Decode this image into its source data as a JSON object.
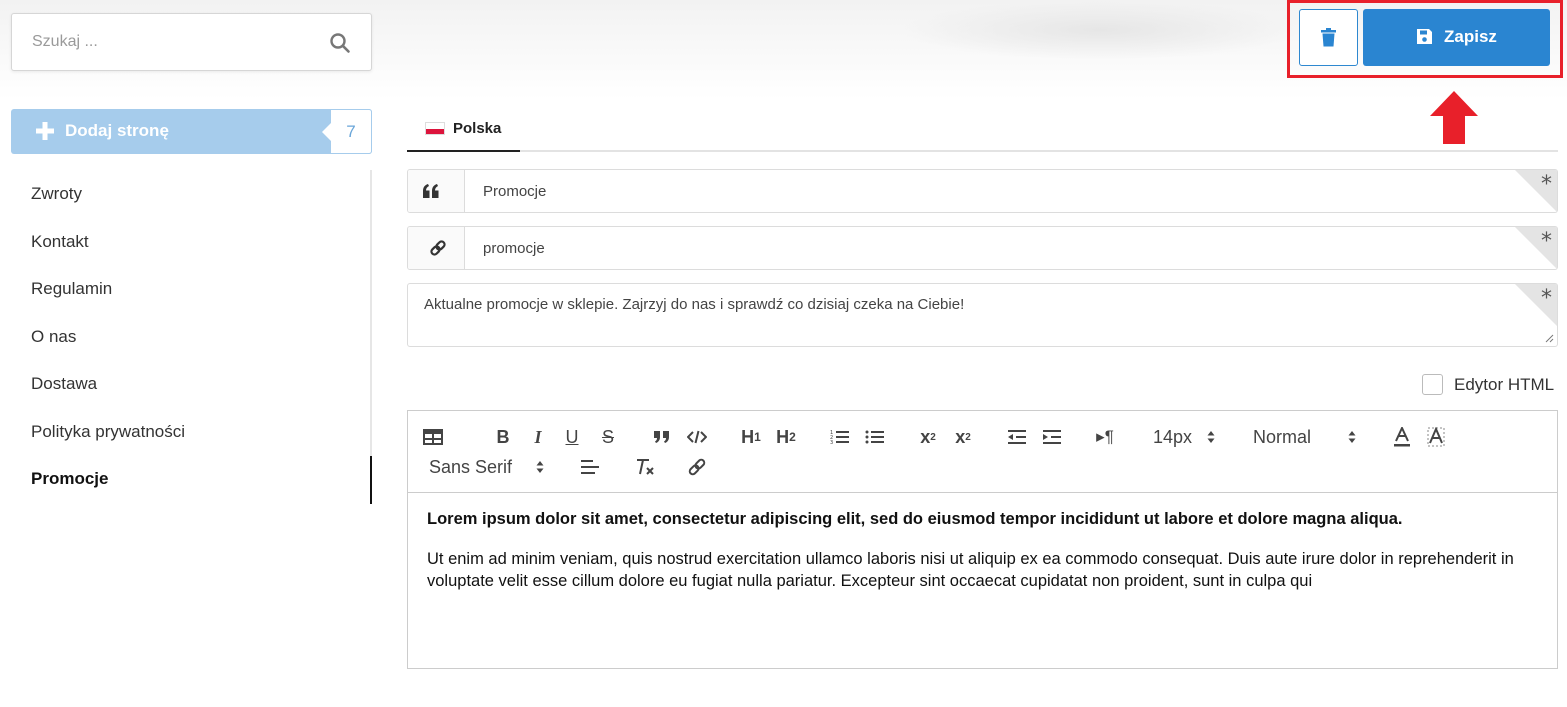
{
  "search": {
    "placeholder": "Szukaj ..."
  },
  "add_page": {
    "label": "Dodaj stronę",
    "count": "7"
  },
  "pages": [
    {
      "label": "Zwroty",
      "active": false
    },
    {
      "label": "Kontakt",
      "active": false
    },
    {
      "label": "Regulamin",
      "active": false
    },
    {
      "label": "O nas",
      "active": false
    },
    {
      "label": "Dostawa",
      "active": false
    },
    {
      "label": "Polityka prywatności",
      "active": false
    },
    {
      "label": "Promocje",
      "active": true
    }
  ],
  "actions": {
    "save_label": "Zapisz",
    "delete_icon": "trash-icon",
    "save_icon": "floppy-disk-icon"
  },
  "tabs": [
    {
      "label": "Polska",
      "flag": "pl-flag-icon",
      "active": true
    }
  ],
  "form": {
    "title_value": "Promocje",
    "slug_value": "promocje",
    "description_value": "Aktualne promocje w sklepie. Zajrzyj do nas i sprawdź co dzisiaj czeka na Ciebie!",
    "required_mark": "*"
  },
  "html_editor_toggle": {
    "label": "Edytor HTML",
    "checked": false
  },
  "toolbar": {
    "font_size": "14px",
    "heading": "Normal",
    "font_family": "Sans Serif"
  },
  "editor_content": {
    "p1": "Lorem ipsum dolor sit amet, consectetur adipiscing elit, sed do eiusmod tempor incididunt ut labore et dolore magna aliqua.",
    "p2": "Ut enim ad minim veniam, quis nostrud exercitation ullamco laboris nisi ut aliquip ex ea commodo consequat. Duis aute irure dolor in reprehenderit in voluptate velit esse cillum dolore eu fugiat nulla pariatur. Excepteur sint occaecat cupidatat non proident, sunt in culpa qui"
  },
  "colors": {
    "primary": "#2a85d1",
    "add_button": "#a6ccec",
    "highlight": "#e8202a"
  }
}
